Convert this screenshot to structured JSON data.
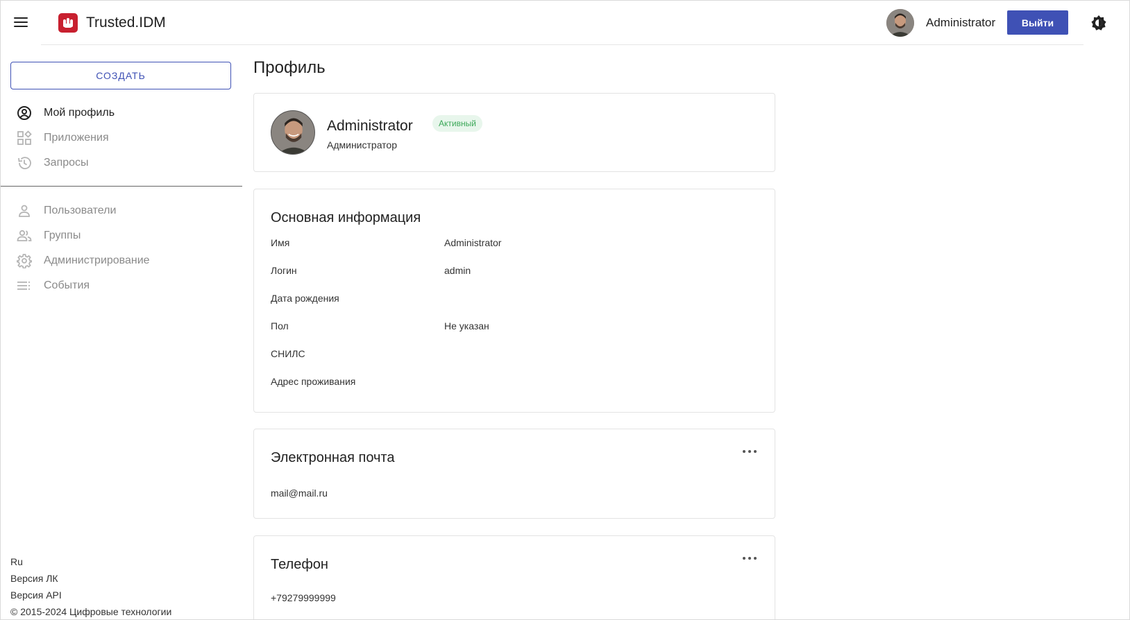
{
  "header": {
    "app_title": "Trusted.IDM",
    "user_name": "Administrator",
    "logout_label": "Выйти"
  },
  "sidebar": {
    "create_label": "СОЗДАТЬ",
    "items": [
      {
        "label": "Мой профиль",
        "icon": "account-circle-icon",
        "active": true
      },
      {
        "label": "Приложения",
        "icon": "apps-icon",
        "active": false
      },
      {
        "label": "Запросы",
        "icon": "history-icon",
        "active": false
      },
      {
        "label": "Пользователи",
        "icon": "person-icon",
        "active": false
      },
      {
        "label": "Группы",
        "icon": "people-icon",
        "active": false
      },
      {
        "label": "Администрирование",
        "icon": "gear-icon",
        "active": false
      },
      {
        "label": "События",
        "icon": "list-icon",
        "active": false
      }
    ],
    "footer": {
      "language": "Ru",
      "lk_version": "Версия ЛК",
      "api_version": "Версия API",
      "copyright": "© 2015-2024 Цифровые технологии"
    }
  },
  "main": {
    "page_title": "Профиль",
    "profile": {
      "name": "Administrator",
      "role": "Администратор",
      "status": "Активный"
    },
    "basic_info": {
      "title": "Основная информация",
      "rows": [
        {
          "label": "Имя",
          "value": "Administrator"
        },
        {
          "label": "Логин",
          "value": "admin"
        },
        {
          "label": "Дата рождения",
          "value": ""
        },
        {
          "label": "Пол",
          "value": "Не указан"
        },
        {
          "label": "СНИЛС",
          "value": ""
        },
        {
          "label": "Адрес проживания",
          "value": ""
        }
      ]
    },
    "email": {
      "title": "Электронная почта",
      "value": "mail@mail.ru"
    },
    "phone": {
      "title": "Телефон",
      "value": "+79279999999"
    }
  },
  "colors": {
    "accent": "#3f51b5",
    "logo": "#c8202f",
    "status_bg": "#e8f6ec",
    "status_text": "#3aa757"
  }
}
